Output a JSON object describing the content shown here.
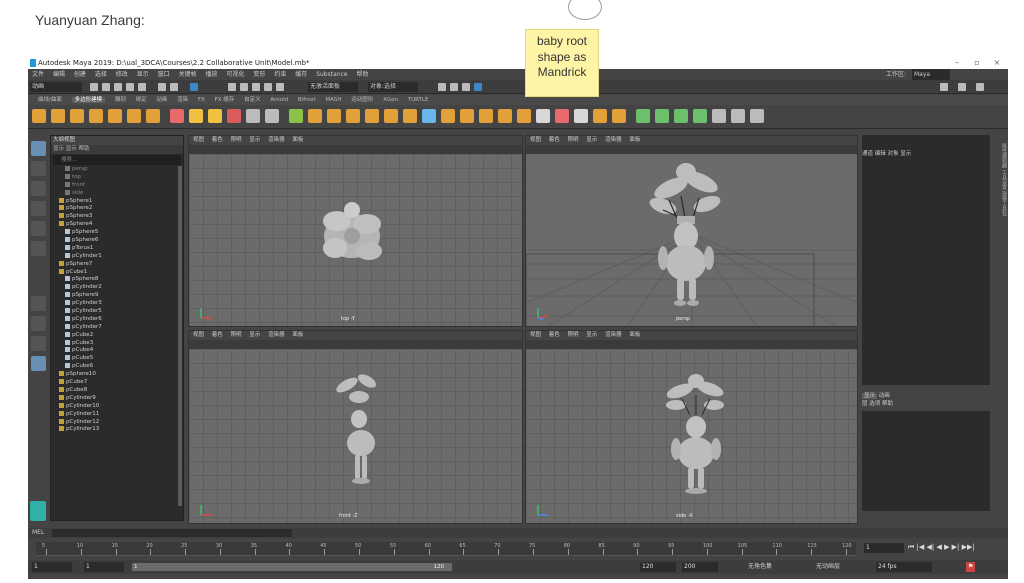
{
  "post": {
    "author": "Yuanyuan Zhang:"
  },
  "note": {
    "lines": [
      "baby root",
      "shape as",
      "Mandrick"
    ]
  },
  "window": {
    "title": "Autodesk Maya 2019: D:\\ual_3DCA\\Courses\\2.2 Collaborative Unit\\Model.mb*",
    "minimize": "–",
    "restore": "▫",
    "close": "×"
  },
  "menubar": {
    "items": [
      "文件",
      "编辑",
      "创建",
      "选择",
      "修改",
      "显示",
      "窗口",
      "关键帧",
      "播放",
      "可视化",
      "变形",
      "约束",
      "缓存",
      "Substance",
      "帮助"
    ],
    "workspace_label": "工作区:",
    "workspace_value": "Maya"
  },
  "statusline": {
    "mode": "动画",
    "search": "无激活面板",
    "render": "对象:选择"
  },
  "shelf_tabs": {
    "items": [
      "曲线/曲面",
      "多边形建模",
      "雕刻",
      "绑定",
      "动画",
      "渲染",
      "FX",
      "FX 缓存",
      "自定义",
      "Arnold",
      "Bifrost",
      "MASH",
      "运动图形",
      "XGen",
      "TURTLE"
    ],
    "active": 1
  },
  "outliner": {
    "title": "大纲视图",
    "menu": [
      "显示",
      "显示",
      "帮助"
    ],
    "search_placeholder": "搜索...",
    "rows": [
      "persp",
      "top",
      "front",
      "side",
      "pSphere1",
      "pSphere2",
      "pSphere3",
      "pSphere4",
      "pSphere5",
      "pSphere6",
      "pTorus1",
      "pCylinder1",
      "pSphere7",
      "pCube1",
      "pSphere8",
      "pCylinder2",
      "pSphere9",
      "pCylinder3",
      "pCylinder5",
      "pCylinder6",
      "pCylinder7",
      "pCube2",
      "pCube3",
      "pCube4",
      "pCube5",
      "pCube6",
      "pSphere10",
      "pCube7",
      "pCube8",
      "pCylinder9",
      "pCylinder10",
      "pCylinder11",
      "pCylinder12",
      "pCylinder13"
    ]
  },
  "viewports": {
    "menu": [
      "视图",
      "着色",
      "照明",
      "显示",
      "渲染器",
      "面板"
    ],
    "top": {
      "label": "top -Y"
    },
    "persp": {
      "label": "persp"
    },
    "front": {
      "label": "front -Z"
    },
    "side": {
      "label": "side -X"
    }
  },
  "rightpanel": {
    "menu": [
      "通道",
      "编辑",
      "对象",
      "显示"
    ],
    "layer_tabs": [
      "显示",
      "动画"
    ],
    "layer_menu": [
      "层",
      "选项",
      "帮助"
    ],
    "side_tabs": "属性编辑器  工具设置  建模工具包"
  },
  "cmdline": {
    "label": "MEL"
  },
  "timeline": {
    "ticks": [
      "5",
      "10",
      "15",
      "20",
      "25",
      "30",
      "35",
      "40",
      "45",
      "50",
      "55",
      "60",
      "65",
      "70",
      "75",
      "80",
      "85",
      "90",
      "95",
      "100",
      "105",
      "110",
      "115",
      "120"
    ],
    "current_frame": "1",
    "controls": "⏮ |◀ ◀| ◀ ▶ ▶| ▶▶|"
  },
  "range": {
    "start": "1",
    "start2": "1",
    "bar_start": "1",
    "bar_end": "120",
    "end": "120",
    "end2": "200",
    "char_set": "无角色集",
    "anim_layer": "无动画层",
    "fps": "24 fps"
  },
  "colors": {
    "maya_bg": "#444444",
    "viewport": "#6b6b6b",
    "sticky": "#fef4a6",
    "shelf_accent": "#e2a03a"
  }
}
